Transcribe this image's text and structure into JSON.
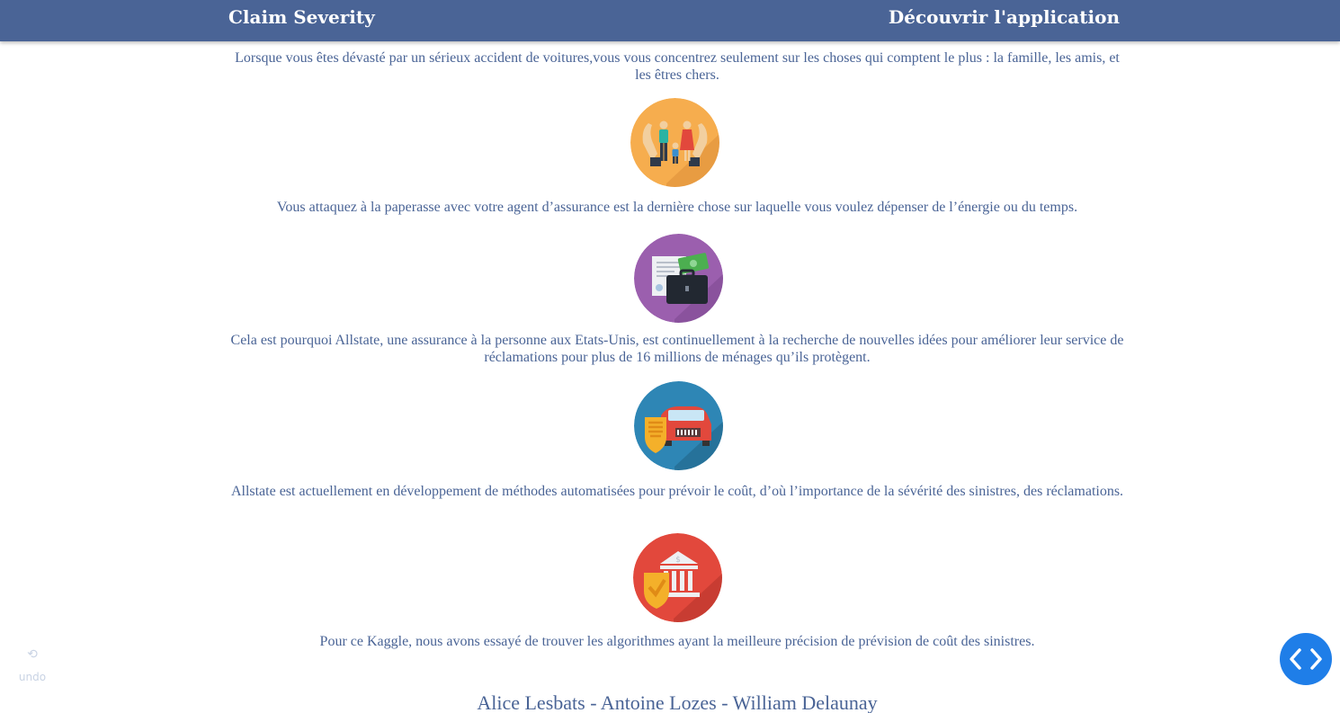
{
  "navbar": {
    "brand": "Claim Severity",
    "link": "Découvrir l'application",
    "background": "#4a6496"
  },
  "content": {
    "paragraphs": [
      "Lorsque vous êtes dévasté par un sérieux accident de voitures,vous vous concentrez seulement sur les choses qui comptent le plus : la famille, les amis, et les êtres chers.",
      "Vous attaquez à la paperasse avec votre agent d’assurance est la dernière chose sur laquelle vous voulez dépenser de l’énergie ou du temps.",
      "Cela est pourquoi Allstate, une assurance à la personne aux Etats-Unis, est continuellement à la recherche de nouvelles idées pour améliorer leur service de réclamations pour plus de 16 millions de ménages qu’ils protègent.",
      "Allstate est actuellement en développement de méthodes automatisées pour prévoir le coût, d’où l’importance de la sévérité des sinistres, des réclamations.",
      "Pour ce Kaggle, nous avons essayé de trouver les algorithmes ayant la meilleure précision de prévision de coût des sinistres."
    ],
    "icons": [
      {
        "name": "family-protection-icon",
        "color": "#f6ad4e"
      },
      {
        "name": "paperwork-briefcase-icon",
        "color": "#9b5fae"
      },
      {
        "name": "car-insurance-shield-icon",
        "color": "#2e86b5"
      },
      {
        "name": "bank-shield-icon",
        "color": "#e2483c"
      }
    ],
    "authors": "Alice Lesbats - Antoine Lozes - William Delaunay"
  },
  "undo": {
    "glyph": "⟲",
    "label": "undo"
  },
  "code_button": {
    "icon": "code-brackets-icon",
    "color": "#1f7ee8"
  }
}
